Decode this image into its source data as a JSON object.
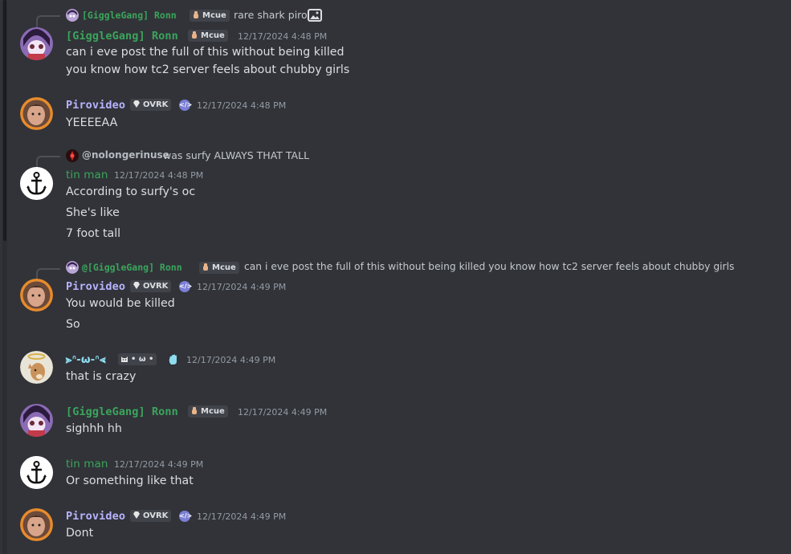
{
  "reply1": {
    "name": "[GiggleGang] Ronn",
    "tag": "Mcue",
    "text": "rare shark piro"
  },
  "m1": {
    "name": "[GiggleGang] Ronn",
    "tag": "Mcue",
    "ts": "12/17/2024 4:48 PM",
    "lines": [
      "can i eve post the full of this without being killed",
      "you know how tc2 server feels about chubby girls"
    ]
  },
  "m2": {
    "name": "Pirovideo",
    "tag": "OVRK",
    "ts": "12/17/2024 4:48 PM",
    "lines": [
      "YEEEEAA"
    ]
  },
  "reply2": {
    "name": "@nolongerinuse",
    "text": "was surfy ALWAYS THAT TALL"
  },
  "m3": {
    "name": "tin man",
    "ts": "12/17/2024 4:48 PM",
    "lines": [
      "According to surfy's oc",
      "She's like",
      "7 foot tall"
    ]
  },
  "reply3": {
    "name": "@[GiggleGang] Ronn",
    "tag": "Mcue",
    "text": "can i eve post the full of this without being killed you know how tc2 server feels about chubby girls"
  },
  "m4": {
    "name": "Pirovideo",
    "tag": "OVRK",
    "ts": "12/17/2024 4:49 PM",
    "lines": [
      "You would be killed",
      "So"
    ]
  },
  "m5": {
    "name": "⪢ᐢ-ω-ᐢ⪡",
    "tag": "• ω •",
    "ts": "12/17/2024 4:49 PM",
    "lines": [
      "that is crazy"
    ]
  },
  "m6": {
    "name": "[GiggleGang] Ronn",
    "tag": "Mcue",
    "ts": "12/17/2024 4:49 PM",
    "lines": [
      "sighhh hh"
    ]
  },
  "m7": {
    "name": "tin man",
    "ts": "12/17/2024 4:49 PM",
    "lines": [
      "Or something like that"
    ]
  },
  "m8": {
    "name": "Pirovideo",
    "tag": "OVRK",
    "ts": "12/17/2024 4:49 PM",
    "lines": [
      "Dont"
    ]
  },
  "icons": {
    "attachment": "image-icon",
    "dev_badge": "code-icon",
    "wave": "wave-hand-icon",
    "tag_gem": "gem-icon",
    "tag_hand": "hand-icon"
  },
  "colors": {
    "background": "#313338",
    "giggle_name": "#3ba55c",
    "piro_name": "#b9b3ff",
    "tin_name": "#3ba55c",
    "kawaii_name": "#8fdcf0"
  }
}
